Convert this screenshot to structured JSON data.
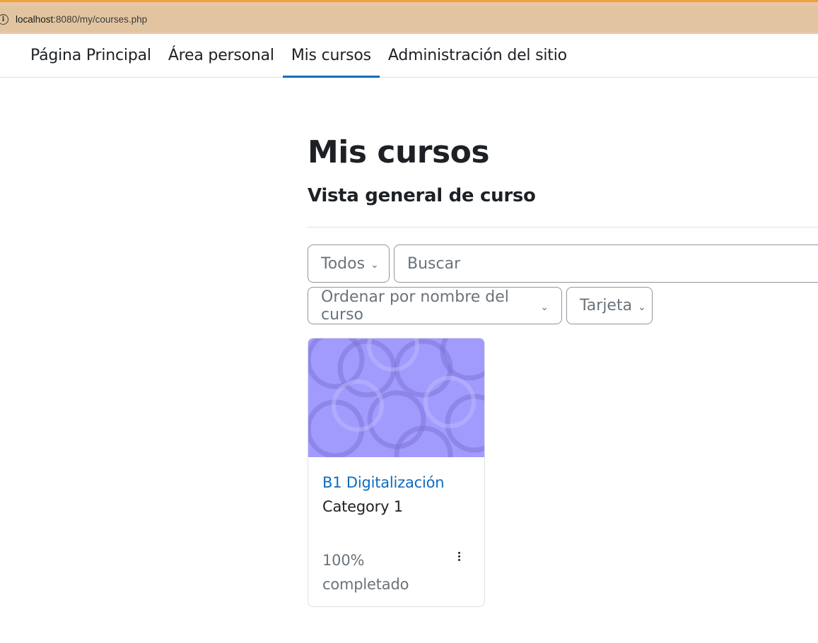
{
  "browser": {
    "url_host": "localhost",
    "url_rest": ":8080/my/courses.php"
  },
  "nav": {
    "items": [
      {
        "label": "Página Principal"
      },
      {
        "label": "Área personal"
      },
      {
        "label": "Mis cursos",
        "active": true
      },
      {
        "label": "Administración del sitio"
      }
    ]
  },
  "main": {
    "title": "Mis cursos",
    "section_title": "Vista general de curso",
    "filters": {
      "grouping_label": "Todos",
      "search_placeholder": "Buscar",
      "sort_label": "Ordenar por nombre del curso",
      "view_label": "Tarjeta"
    },
    "courses": [
      {
        "name": "B1 Digitalización",
        "category": "Category 1",
        "progress_text": "100% completado",
        "progress": 100
      }
    ]
  },
  "colors": {
    "accent": "#0f6cbf",
    "card_image": "#a29bfe",
    "address_bar": "#e2c5a0"
  },
  "icons": [
    "info-icon",
    "chevron-down-icon",
    "kebab-menu-icon"
  ]
}
